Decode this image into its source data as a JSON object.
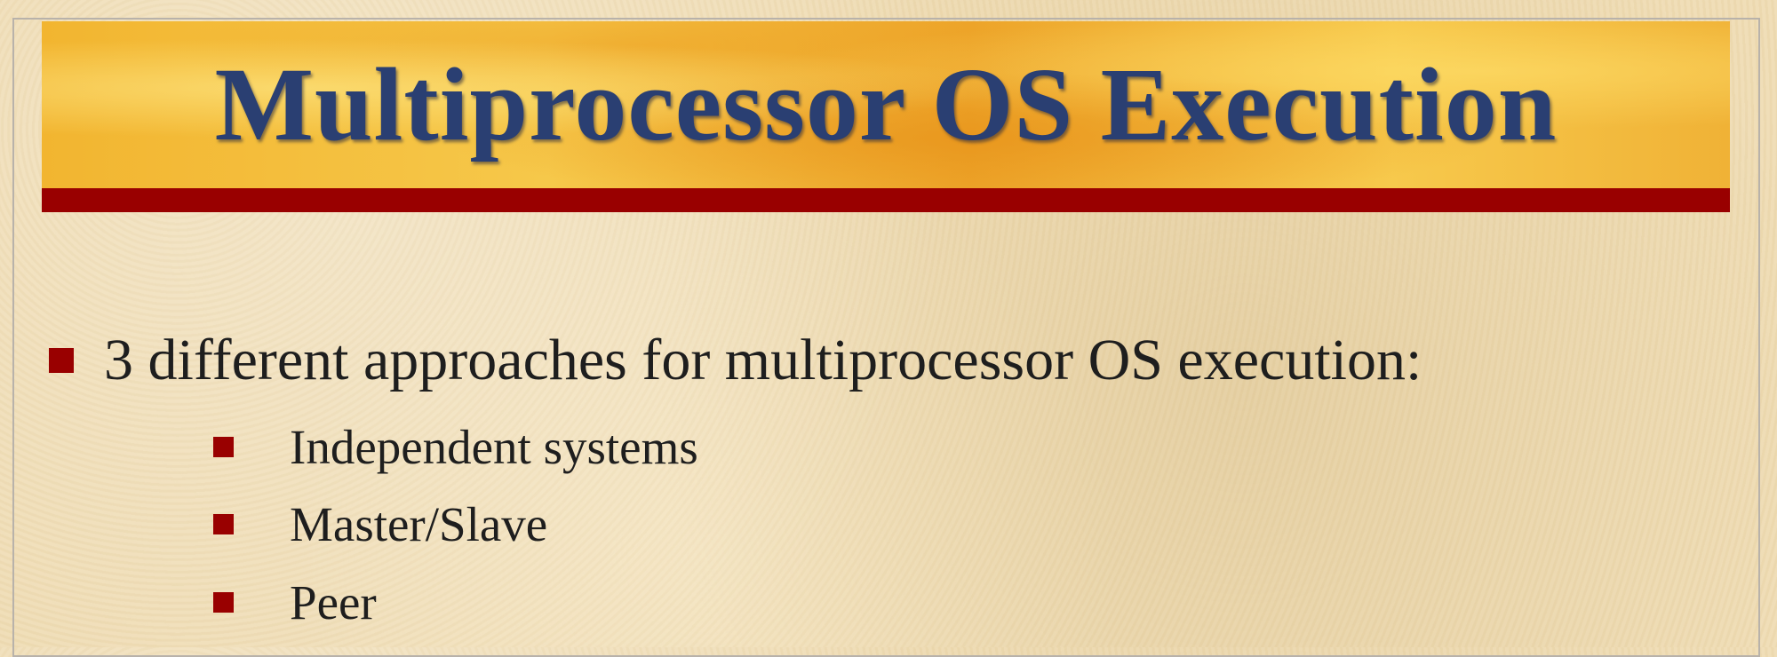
{
  "slide": {
    "title": "Multiprocessor OS Execution",
    "bullets": [
      {
        "text": "3 different approaches for multiprocessor OS execution:",
        "sub_items": [
          {
            "text": "Independent systems"
          },
          {
            "text": "Master/Slave"
          },
          {
            "text": "Peer"
          }
        ]
      }
    ]
  },
  "colors": {
    "title_text": "#2a3f72",
    "title_rule": "#990000",
    "bullet_marker": "#990000",
    "banner_gold": "#f2b530",
    "background": "#efdcb4"
  }
}
